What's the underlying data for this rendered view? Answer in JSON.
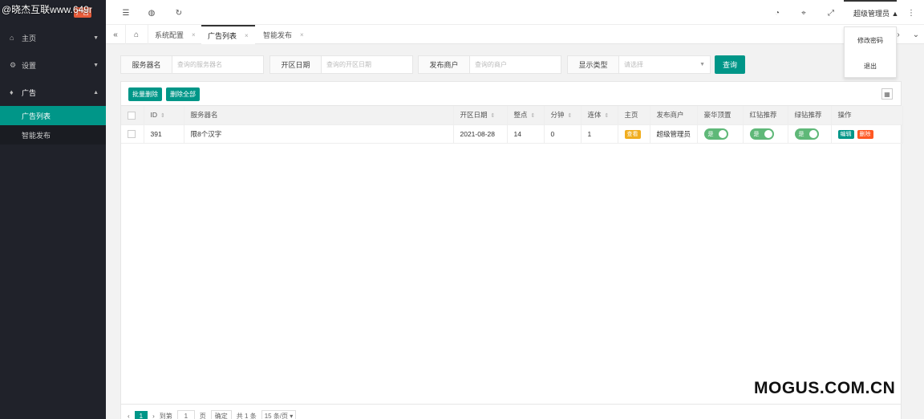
{
  "watermark_top": "@晓杰互联www.649r",
  "logo": {
    "badge": "广告"
  },
  "sidebar": {
    "items": [
      {
        "label": "主页",
        "icon": "home-icon"
      },
      {
        "label": "设置",
        "icon": "gear-icon"
      },
      {
        "label": "广告",
        "icon": "diamond-icon"
      }
    ],
    "subitems": [
      {
        "label": "广告列表",
        "active": true
      },
      {
        "label": "智能发布",
        "active": false
      }
    ]
  },
  "header": {
    "admin": "超级管理员",
    "menu": [
      "修改密码",
      "退出"
    ]
  },
  "tabs": [
    "系统配置",
    "广告列表",
    "智能发布"
  ],
  "search": {
    "fields": [
      {
        "label": "服务器名",
        "placeholder": "查询的服务器名"
      },
      {
        "label": "开区日期",
        "placeholder": "查询的开区日期"
      },
      {
        "label": "发布商户",
        "placeholder": "查询的商户"
      },
      {
        "label": "显示类型",
        "placeholder": "请选择"
      }
    ],
    "query_button": "查询"
  },
  "toolbar": {
    "batch_delete": "批量删除",
    "delete_all": "删除全部"
  },
  "table": {
    "headers": [
      "ID",
      "服务器名",
      "开区日期",
      "整点",
      "分钟",
      "连体",
      "主页",
      "发布商户",
      "豪华顶置",
      "红钻推荐",
      "绿钻推荐",
      "操作"
    ],
    "rows": [
      {
        "id": "391",
        "name": "限8个汉字",
        "date": "2021-08-28",
        "hour": "14",
        "minute": "0",
        "linked": "1",
        "home": "查看",
        "merchant": "超级管理员",
        "switch_label": "是",
        "edit": "编辑",
        "delete": "删除"
      }
    ]
  },
  "pager": {
    "current": "1",
    "goto_label": "到第",
    "goto_value": "1",
    "page_unit": "页",
    "confirm": "确定",
    "total": "共 1 条",
    "per_page": "15 条/页"
  },
  "watermark_bottom": "MOGUS.COM.CN",
  "colors": {
    "accent": "#009688",
    "sidebar": "#20222a",
    "danger": "#ff5722",
    "warn": "#f0ad1e",
    "switch": "#5fb878"
  }
}
